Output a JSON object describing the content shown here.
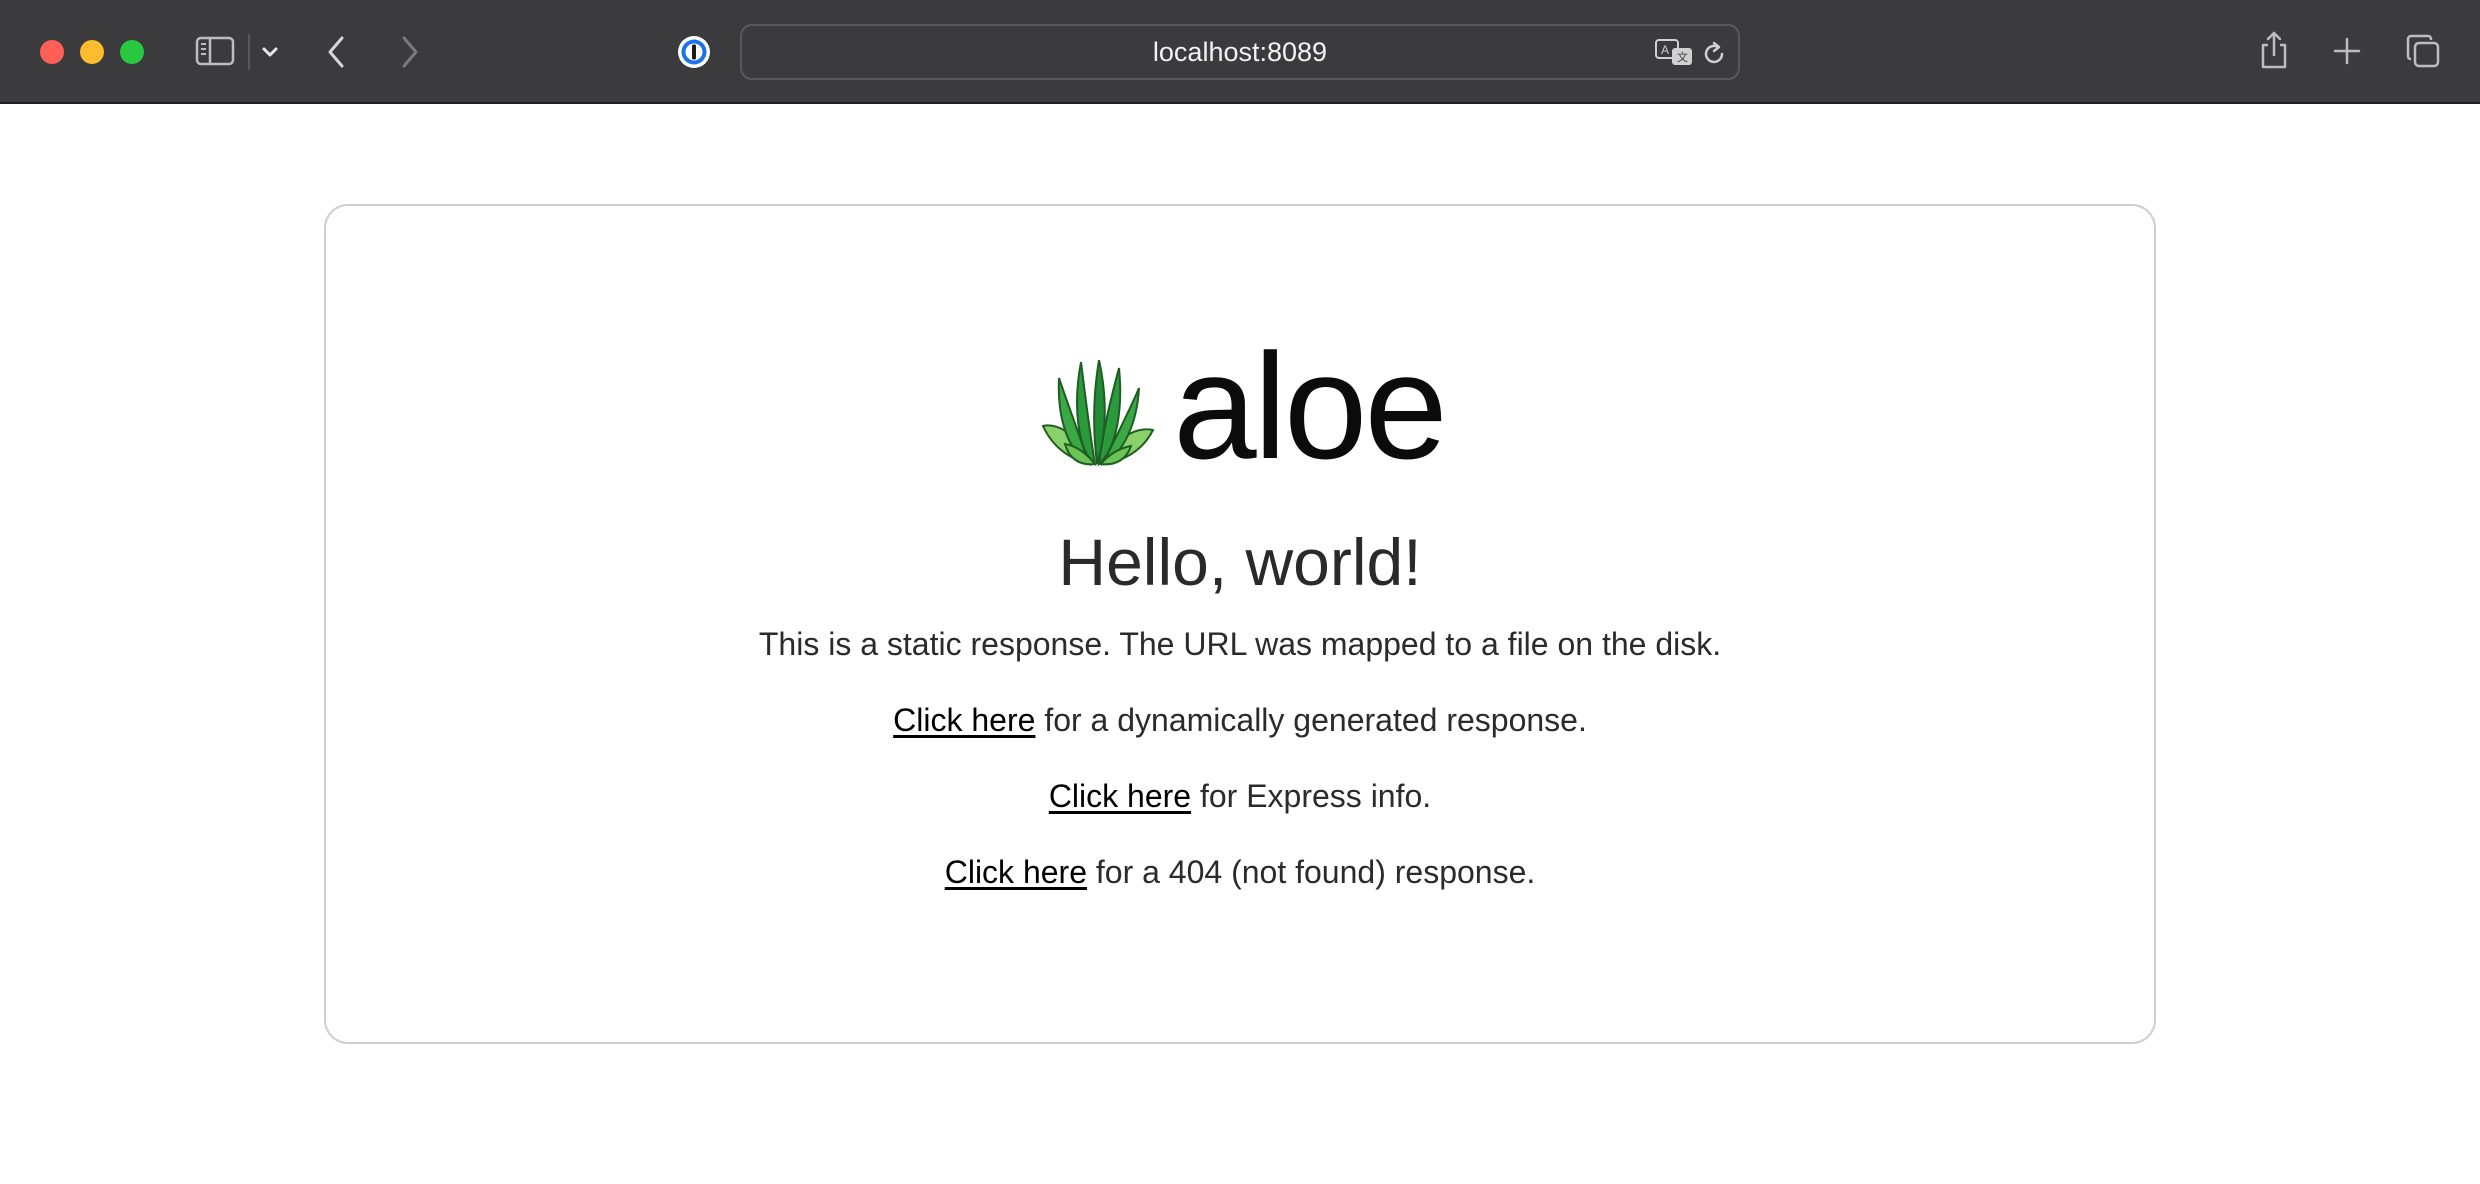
{
  "browser": {
    "url": "localhost:8089",
    "icons": {
      "sidebar": "sidebar-icon",
      "sidebar_menu": "chevron-down-icon",
      "back": "chevron-left-icon",
      "forward": "chevron-right-icon",
      "password_manager": "1password-icon",
      "translate": "translate-icon",
      "reload": "reload-icon",
      "share": "share-icon",
      "new_tab": "plus-icon",
      "tab_overview": "tabs-icon"
    }
  },
  "page": {
    "logo_text": "aloe",
    "heading": "Hello, world!",
    "intro": "This is a static response. The URL was mapped to a file on the disk.",
    "links": [
      {
        "label": "Click here",
        "suffix": " for a dynamically generated response."
      },
      {
        "label": "Click here",
        "suffix": " for Express info."
      },
      {
        "label": "Click here",
        "suffix": " for a 404 (not found) response."
      }
    ]
  },
  "colors": {
    "toolbar": "#3b3b3d",
    "close": "#ff5f57",
    "minimize": "#febc2e",
    "maximize": "#28c840",
    "logo_green": "#3aa845"
  }
}
